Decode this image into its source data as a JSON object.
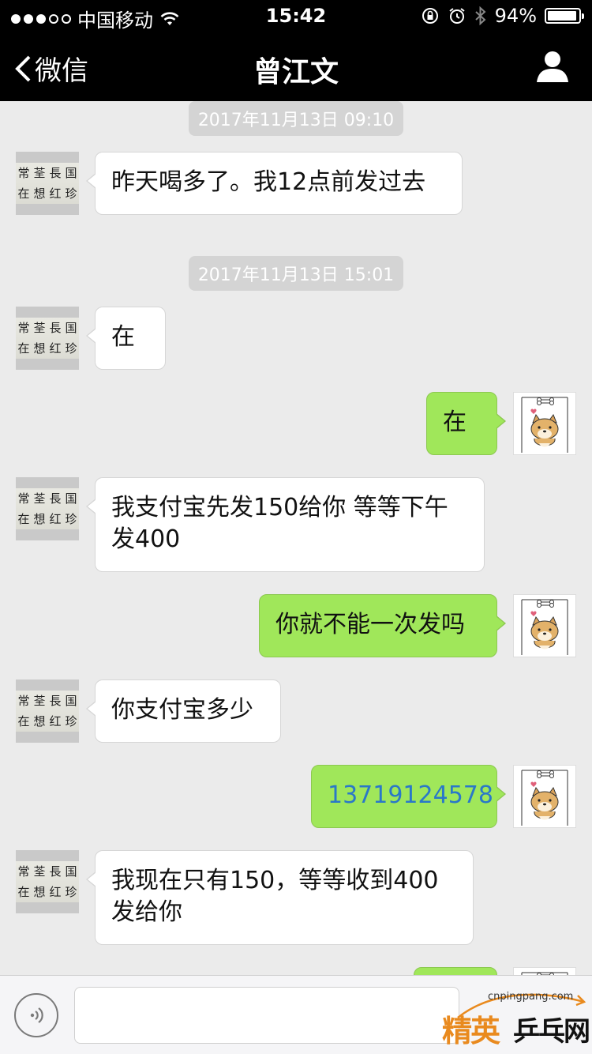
{
  "status_bar": {
    "carrier": "中国移动",
    "time": "15:42",
    "battery_text": "94%",
    "battery_level": 0.94,
    "signal_bars_filled": 3,
    "signal_bars_total": 5
  },
  "nav": {
    "back_label": "微信",
    "title": "曾江文"
  },
  "avatar_calligraphy": [
    "常",
    "荃",
    "長",
    "国",
    "在",
    "想",
    "红",
    "珍"
  ],
  "messages": {
    "ts1": "2017年11月13日 09:10",
    "m1": "昨天喝多了。我12点前发过去",
    "ts2": "2017年11月13日 15:01",
    "m2": "在",
    "m3": "在",
    "m4": "我支付宝先发150给你 等等下午发400",
    "m5": "你就不能一次发吗",
    "m6": "你支付宝多少",
    "m7": "13719124578",
    "m8": "我现在只有150，等等收到400发给你"
  },
  "input": {
    "placeholder": ""
  },
  "watermark": {
    "url": "cnpingpang.com",
    "main": "精英",
    "sub": "乒乓网"
  },
  "colors": {
    "outgoing_bubble": "#a0e75a",
    "incoming_bubble": "#ffffff",
    "link": "#2a78c8",
    "header": "#000000"
  }
}
